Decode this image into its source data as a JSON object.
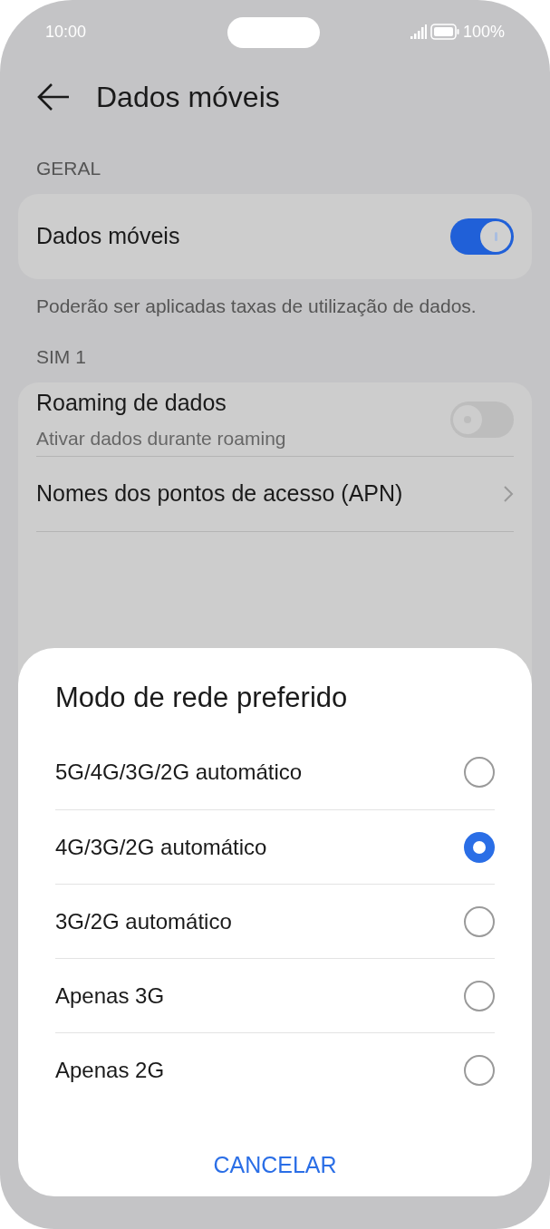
{
  "status_bar": {
    "time": "10:00",
    "battery": "100%"
  },
  "header": {
    "title": "Dados móveis"
  },
  "sections": [
    {
      "heading": "GERAL",
      "items": [
        {
          "kind": "toggle",
          "label": "Dados móveis",
          "on": true
        }
      ],
      "note": "Poderão ser aplicadas taxas de utilização de dados."
    },
    {
      "heading": "SIM 1",
      "items": [
        {
          "kind": "toggle",
          "label": "Roaming de dados",
          "sublabel": "Ativar dados durante roaming",
          "on": false
        },
        {
          "kind": "link",
          "label": "Nomes dos pontos de acesso (APN)"
        }
      ]
    }
  ],
  "dialog": {
    "title": "Modo de rede preferido",
    "options": [
      {
        "label": "5G/4G/3G/2G automático",
        "selected": false
      },
      {
        "label": "4G/3G/2G automático",
        "selected": true
      },
      {
        "label": "3G/2G automático",
        "selected": false
      },
      {
        "label": "Apenas 3G",
        "selected": false
      },
      {
        "label": "Apenas 2G",
        "selected": false
      }
    ],
    "cancel": "CANCELAR"
  }
}
